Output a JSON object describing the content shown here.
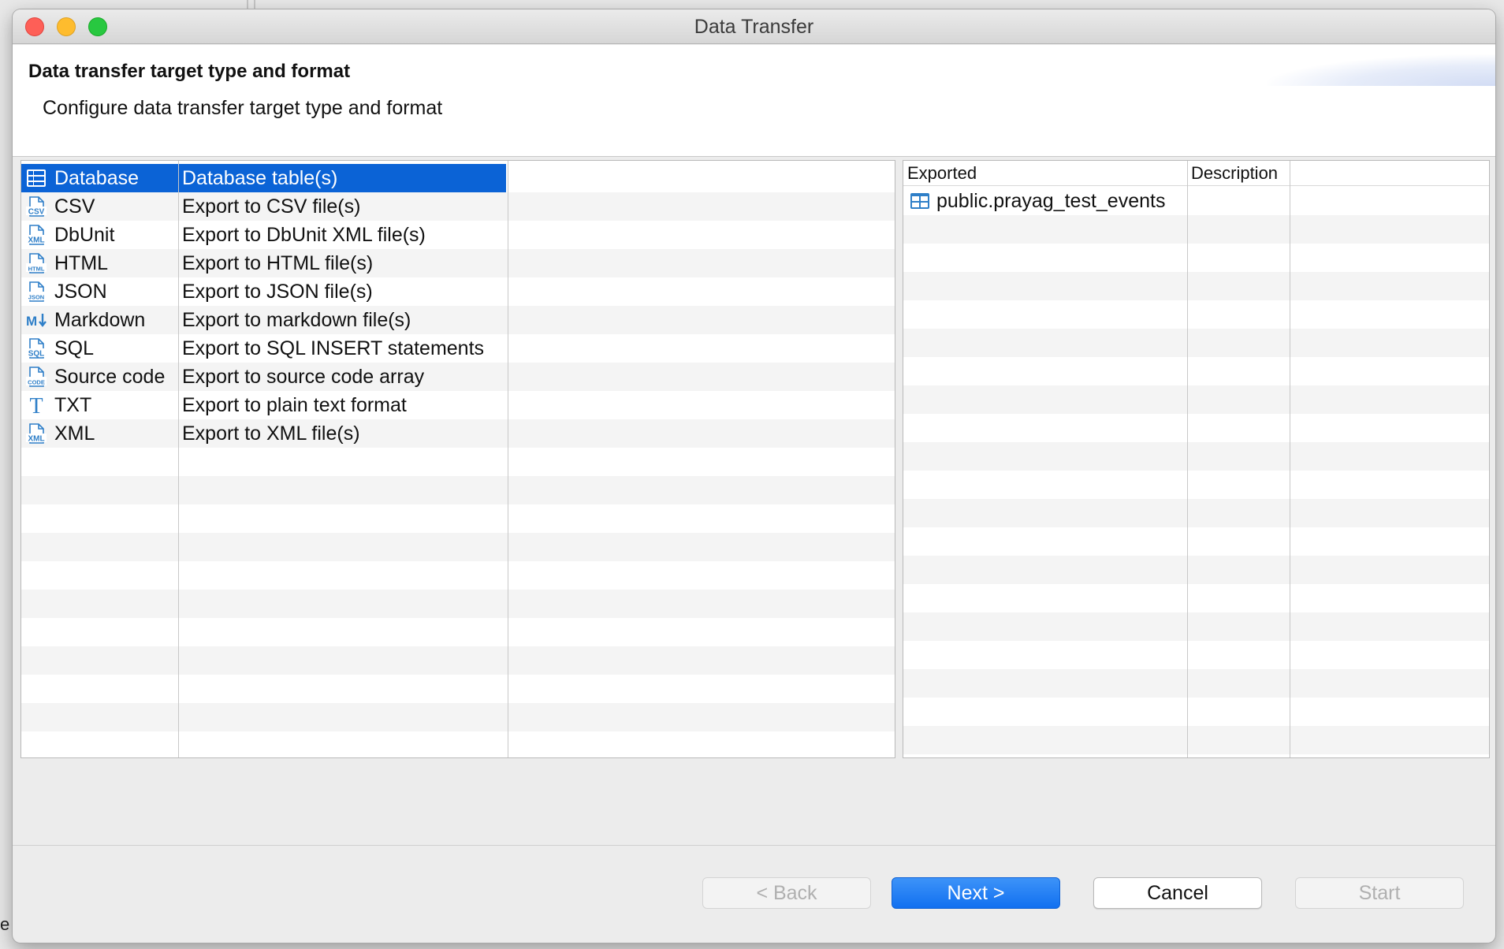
{
  "window": {
    "title": "Data Transfer"
  },
  "header": {
    "title": "Data transfer target type and format",
    "subtitle": "Configure data transfer target type and format"
  },
  "formats": [
    {
      "name": "Database",
      "description": "Database table(s)",
      "icon": "database-icon",
      "selected": true
    },
    {
      "name": "CSV",
      "description": "Export to CSV file(s)",
      "icon": "csv-file-icon",
      "selected": false
    },
    {
      "name": "DbUnit",
      "description": "Export to DbUnit XML file(s)",
      "icon": "xml-file-icon",
      "selected": false
    },
    {
      "name": "HTML",
      "description": "Export to HTML file(s)",
      "icon": "html-file-icon",
      "selected": false
    },
    {
      "name": "JSON",
      "description": "Export to JSON file(s)",
      "icon": "json-file-icon",
      "selected": false
    },
    {
      "name": "Markdown",
      "description": "Export to markdown file(s)",
      "icon": "markdown-icon",
      "selected": false
    },
    {
      "name": "SQL",
      "description": "Export to SQL INSERT statements",
      "icon": "sql-file-icon",
      "selected": false
    },
    {
      "name": "Source code",
      "description": "Export to source code array",
      "icon": "code-file-icon",
      "selected": false
    },
    {
      "name": "TXT",
      "description": "Export to plain text format",
      "icon": "text-icon",
      "selected": false
    },
    {
      "name": "XML",
      "description": "Export to XML file(s)",
      "icon": "xml-file-icon",
      "selected": false
    }
  ],
  "exported_table": {
    "columns": [
      "Exported",
      "Description"
    ],
    "rows": [
      {
        "exported": "public.prayag_test_events",
        "description": "",
        "icon": "table-icon"
      }
    ]
  },
  "buttons": {
    "back": "< Back",
    "next": "Next >",
    "cancel": "Cancel",
    "start": "Start"
  },
  "colors": {
    "selection": "#0b63d6",
    "primary_button": "#1170f0",
    "icon_blue": "#2f7fc8"
  }
}
